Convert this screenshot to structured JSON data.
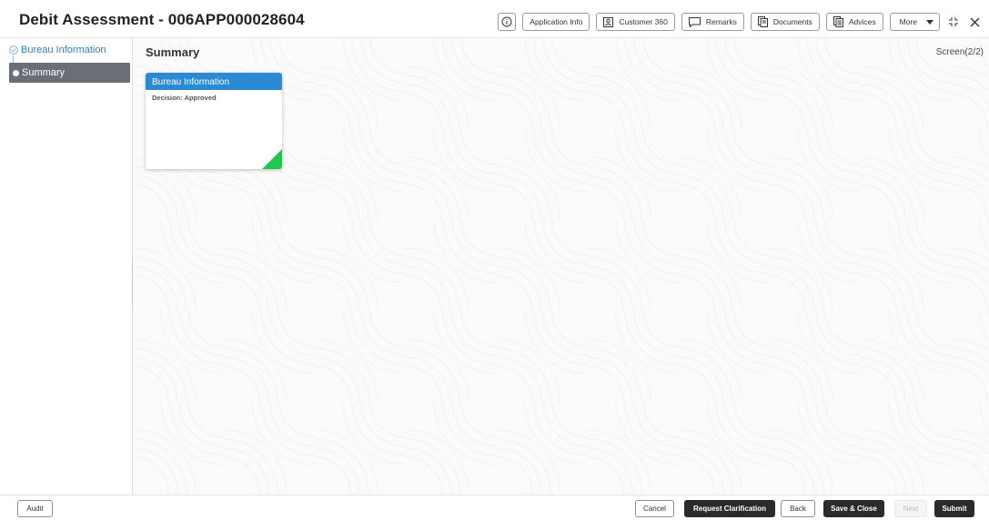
{
  "header": {
    "title": "Debit Assessment - 006APP000028604",
    "toolbar": {
      "application_info": "Application Info",
      "customer_360": "Customer 360",
      "remarks": "Remarks",
      "documents": "Documents",
      "advices": "Advices",
      "more": "More"
    }
  },
  "sidebar": {
    "steps": [
      {
        "label": "Bureau Information",
        "state": "completed"
      },
      {
        "label": "Summary",
        "state": "active"
      }
    ]
  },
  "main": {
    "section_title": "Summary",
    "screen_count": "Screen(2/2)",
    "cards": [
      {
        "title": "Bureau Information",
        "detail": "Decision: Approved"
      }
    ]
  },
  "footer": {
    "audit": "Audit",
    "cancel": "Cancel",
    "request_clarification": "Request Clarification",
    "back": "Back",
    "save_close": "Save & Close",
    "next": "Next",
    "submit": "Submit"
  },
  "colors": {
    "accent_blue": "#2c8ad5",
    "active_step_bg": "#6a6e75",
    "status_green": "#1dc94e",
    "dark_button": "#2b2b2b"
  }
}
